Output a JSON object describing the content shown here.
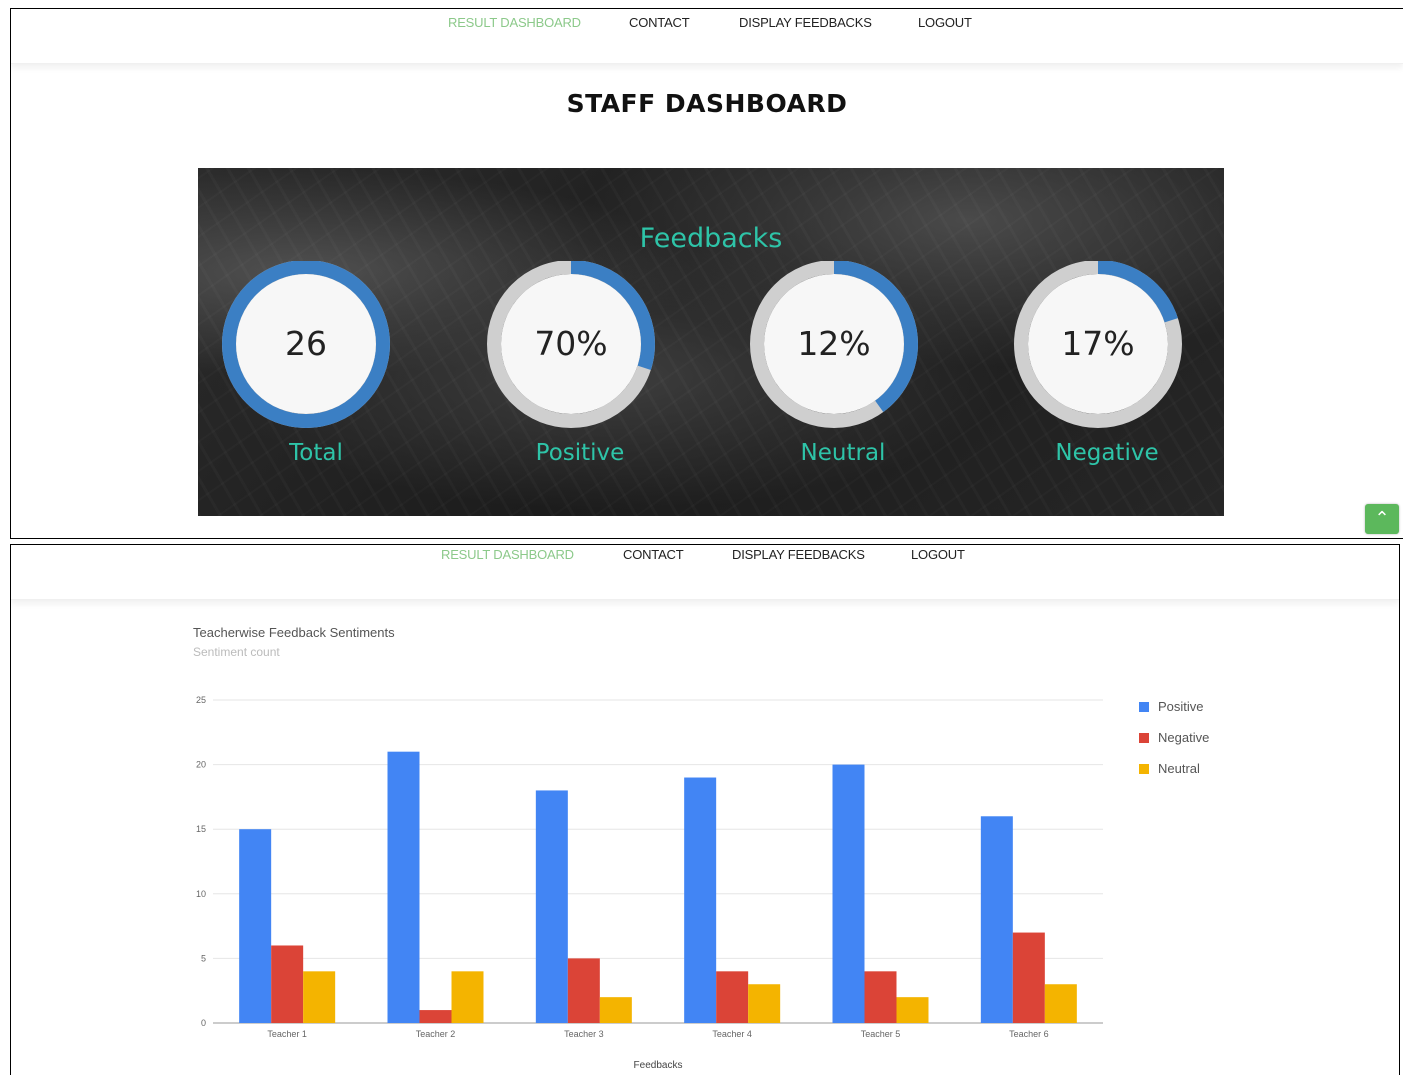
{
  "nav": {
    "items": [
      {
        "label": "RESULT DASHBOARD",
        "active": true
      },
      {
        "label": "CONTACT",
        "active": false
      },
      {
        "label": "DISPLAY FEEDBACKS",
        "active": false
      },
      {
        "label": "LOGOUT",
        "active": false
      }
    ],
    "active_color": "#8cc98a"
  },
  "page_title": "STAFF DASHBOARD",
  "feedbacks": {
    "heading": "Feedbacks",
    "accent_color": "#2ec4a8",
    "ring_color": "#3b7fc4",
    "track_color": "#cfcfcf",
    "gauges": [
      {
        "value_text": "26",
        "label": "Total",
        "fill_fraction": 1.0
      },
      {
        "value_text": "70%",
        "label": "Positive",
        "fill_fraction": 0.3
      },
      {
        "value_text": "12%",
        "label": "Neutral",
        "fill_fraction": 0.4
      },
      {
        "value_text": "17%",
        "label": "Negative",
        "fill_fraction": 0.2
      }
    ]
  },
  "scroll_top_icon": "chevron-up-icon",
  "chart_data": {
    "type": "bar",
    "title": "Teacherwise Feedback Sentiments",
    "subtitle": "Sentiment count",
    "xlabel": "Feedbacks",
    "ylabel": "",
    "ylim": [
      0,
      25
    ],
    "yticks": [
      0,
      5,
      10,
      15,
      20,
      25
    ],
    "grid": true,
    "legend_position": "right",
    "categories": [
      "Teacher 1",
      "Teacher 2",
      "Teacher 3",
      "Teacher 4",
      "Teacher 5",
      "Teacher 6"
    ],
    "series": [
      {
        "name": "Positive",
        "color": "#4285f4",
        "values": [
          15,
          21,
          18,
          19,
          20,
          16
        ]
      },
      {
        "name": "Negative",
        "color": "#db4437",
        "values": [
          6,
          1,
          5,
          4,
          4,
          7
        ]
      },
      {
        "name": "Neutral",
        "color": "#f4b400",
        "values": [
          4,
          4,
          2,
          3,
          2,
          3
        ]
      }
    ]
  }
}
